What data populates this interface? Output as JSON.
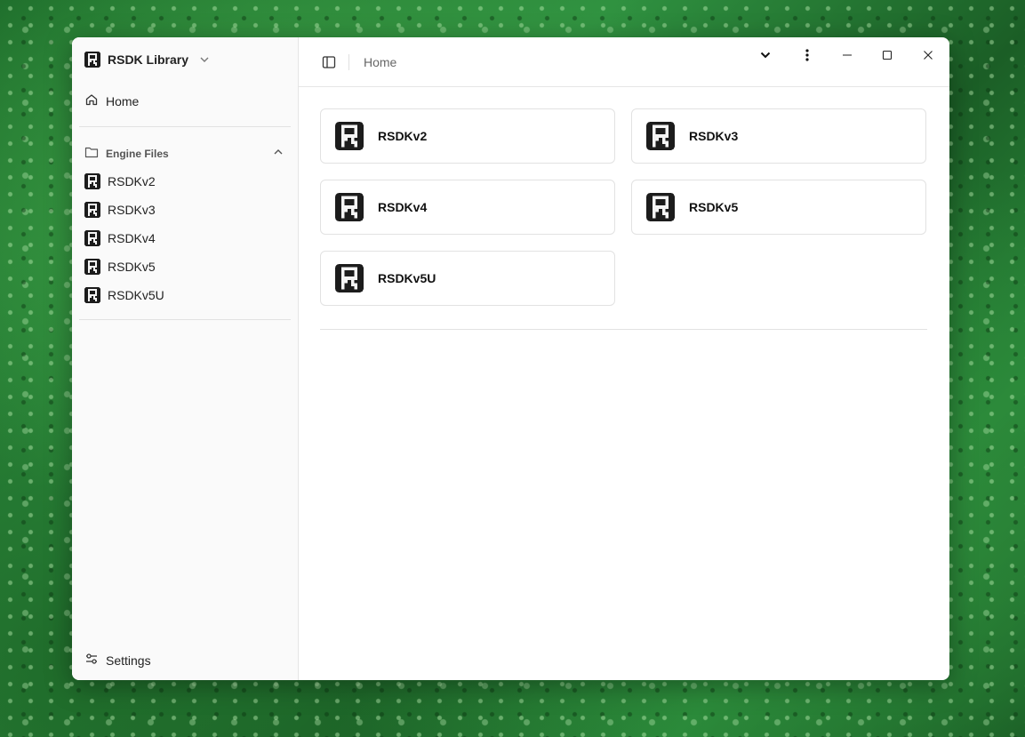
{
  "app": {
    "library_title": "RSDK Library"
  },
  "sidebar": {
    "home_label": "Home",
    "group_label": "Engine Files",
    "items": [
      {
        "label": "RSDKv2",
        "accent": "#555555"
      },
      {
        "label": "RSDKv3",
        "accent": "#d9333a"
      },
      {
        "label": "RSDKv4",
        "accent": "#2f7ad3"
      },
      {
        "label": "RSDKv5",
        "accent": "#e3b63a"
      },
      {
        "label": "RSDKv5U",
        "accent": "#e07a2b"
      }
    ],
    "settings_label": "Settings"
  },
  "header": {
    "breadcrumb": "Home"
  },
  "cards": [
    {
      "label": "RSDKv2",
      "accent": "#555555"
    },
    {
      "label": "RSDKv3",
      "accent": "#d9333a"
    },
    {
      "label": "RSDKv4",
      "accent": "#2f7ad3"
    },
    {
      "label": "RSDKv5",
      "accent": "#e3b63a"
    },
    {
      "label": "RSDKv5U",
      "accent": "#e07a2b"
    }
  ],
  "icons": {
    "panel": "sidebar-toggle-icon",
    "home": "home-icon",
    "folder": "folder-icon",
    "settings": "sliders-icon",
    "chevron": "chevron-down-icon",
    "more": "kebab-menu-icon",
    "minimize": "minimize-icon",
    "maximize": "maximize-icon",
    "close": "close-icon"
  }
}
